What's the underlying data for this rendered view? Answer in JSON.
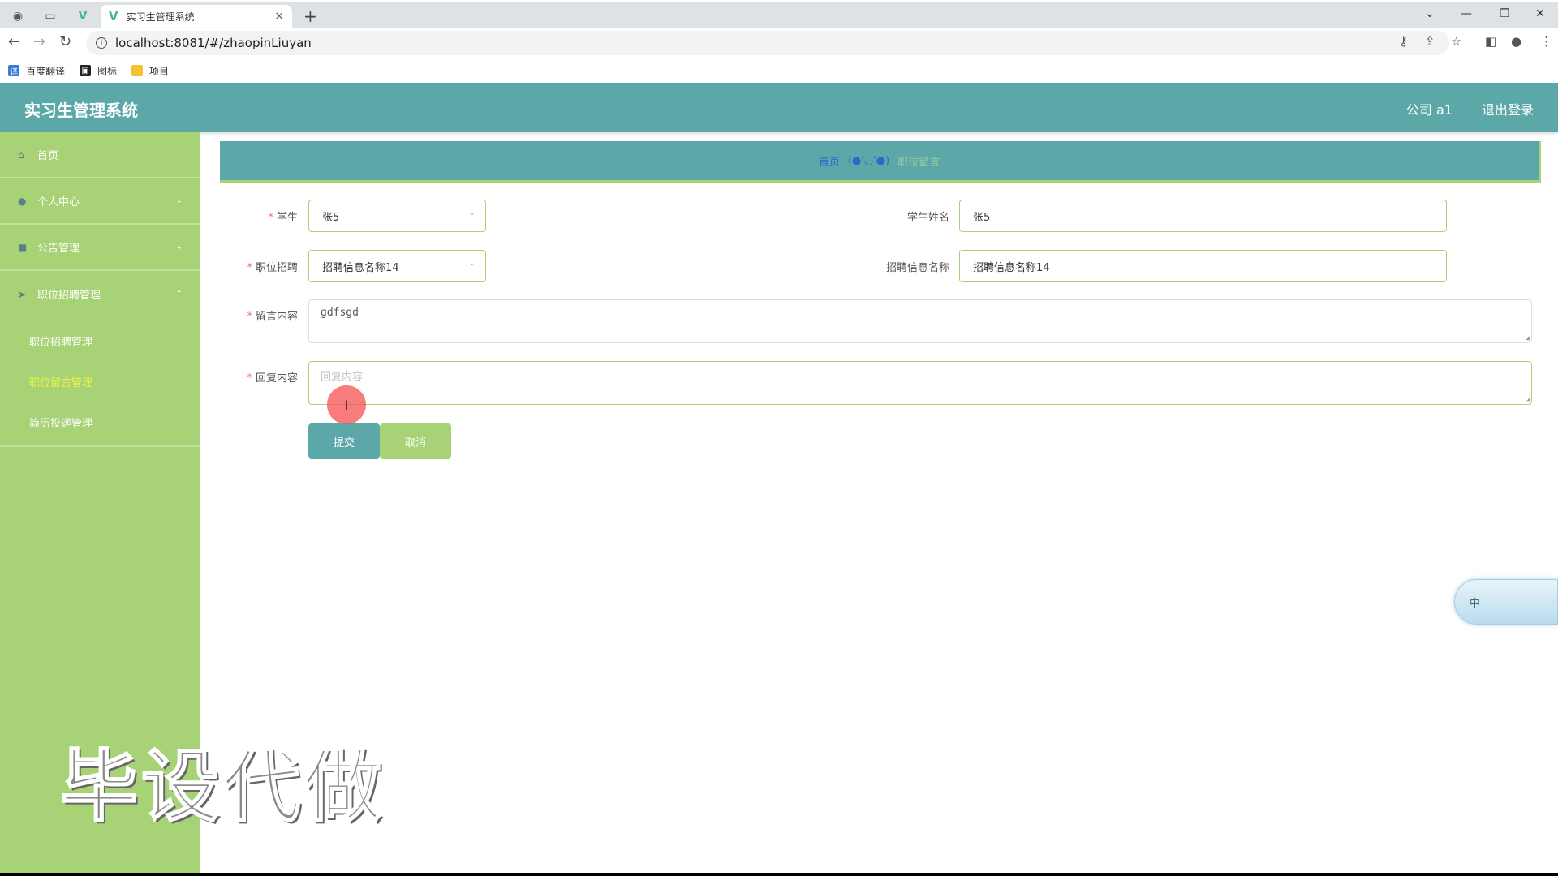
{
  "browser": {
    "tab_title": "实习生管理系统",
    "tab_close": "×",
    "new_tab": "+",
    "url": "localhost:8081/#/zhaopinLiuyan",
    "bookmarks": [
      {
        "label": "百度翻译",
        "icon": "translate-icon",
        "color": "#3a7bd5"
      },
      {
        "label": "图标",
        "icon": "image-icon",
        "color": "#222222"
      },
      {
        "label": "项目",
        "icon": "folder-icon",
        "color": "#f4c430"
      }
    ]
  },
  "header": {
    "title": "实习生管理系统",
    "user": "公司 a1",
    "logout": "退出登录"
  },
  "sidebar": {
    "items": [
      {
        "label": "首页",
        "icon": "home-icon"
      },
      {
        "label": "个人中心",
        "icon": "user-icon",
        "expandable": true
      },
      {
        "label": "公告管理",
        "icon": "notice-icon",
        "expandable": true
      },
      {
        "label": "职位招聘管理",
        "icon": "send-icon",
        "expandable": true,
        "expanded": true
      }
    ],
    "subitems": [
      {
        "label": "职位招聘管理",
        "active": false
      },
      {
        "label": "职位留言管理",
        "active": true
      },
      {
        "label": "简历投递管理",
        "active": false
      }
    ]
  },
  "breadcrumb": {
    "home": "首页",
    "separator": "(●'◡'●)",
    "current": "职位留言"
  },
  "form": {
    "student_label": "学生",
    "student_value": "张5",
    "student_name_label": "学生姓名",
    "student_name_value": "张5",
    "job_label": "职位招聘",
    "job_value": "招聘信息名称14",
    "job_name_label": "招聘信息名称",
    "job_name_value": "招聘信息名称14",
    "message_label": "留言内容",
    "message_value": "gdfsgd",
    "reply_label": "回复内容",
    "reply_placeholder": "回复内容",
    "required_mark": "*",
    "submit": "提交",
    "cancel": "取消"
  },
  "overlay": {
    "ime_label": "中",
    "watermark": "毕设代做"
  },
  "colors": {
    "primary": "#5ca8a8",
    "sidebar": "#a7d276",
    "active_submenu": "#eaf34a",
    "required": "#f56c6c"
  }
}
